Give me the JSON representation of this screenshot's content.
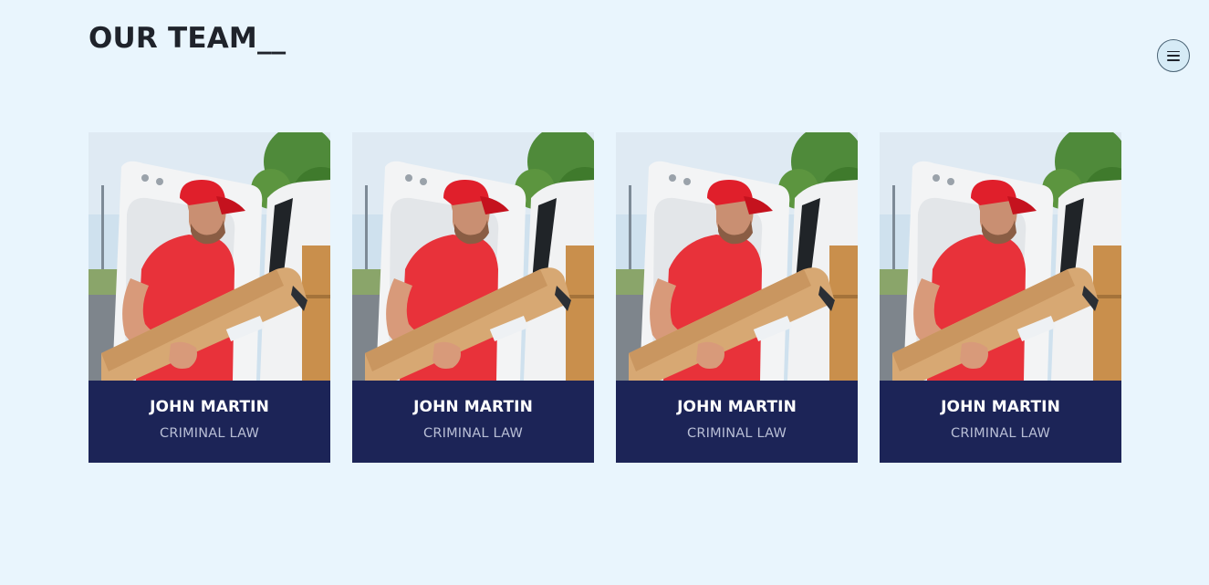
{
  "header": {
    "title": "OUR TEAM__"
  },
  "menu": {
    "icon": "hamburger-menu-icon"
  },
  "team": [
    {
      "name": "JOHN MARTIN",
      "role": "CRIMINAL LAW",
      "photo": "delivery-man-with-box-photo"
    },
    {
      "name": "JOHN MARTIN",
      "role": "CRIMINAL LAW",
      "photo": "delivery-man-with-box-photo"
    },
    {
      "name": "JOHN MARTIN",
      "role": "CRIMINAL LAW",
      "photo": "delivery-man-with-box-photo"
    },
    {
      "name": "JOHN MARTIN",
      "role": "CRIMINAL LAW",
      "photo": "delivery-man-with-box-photo"
    }
  ],
  "colors": {
    "page_background": "#e9f5fd",
    "caption_background": "#1c2457",
    "name_text": "#ffffff",
    "role_text": "#b9bfd6",
    "title_text": "#1f232b"
  }
}
